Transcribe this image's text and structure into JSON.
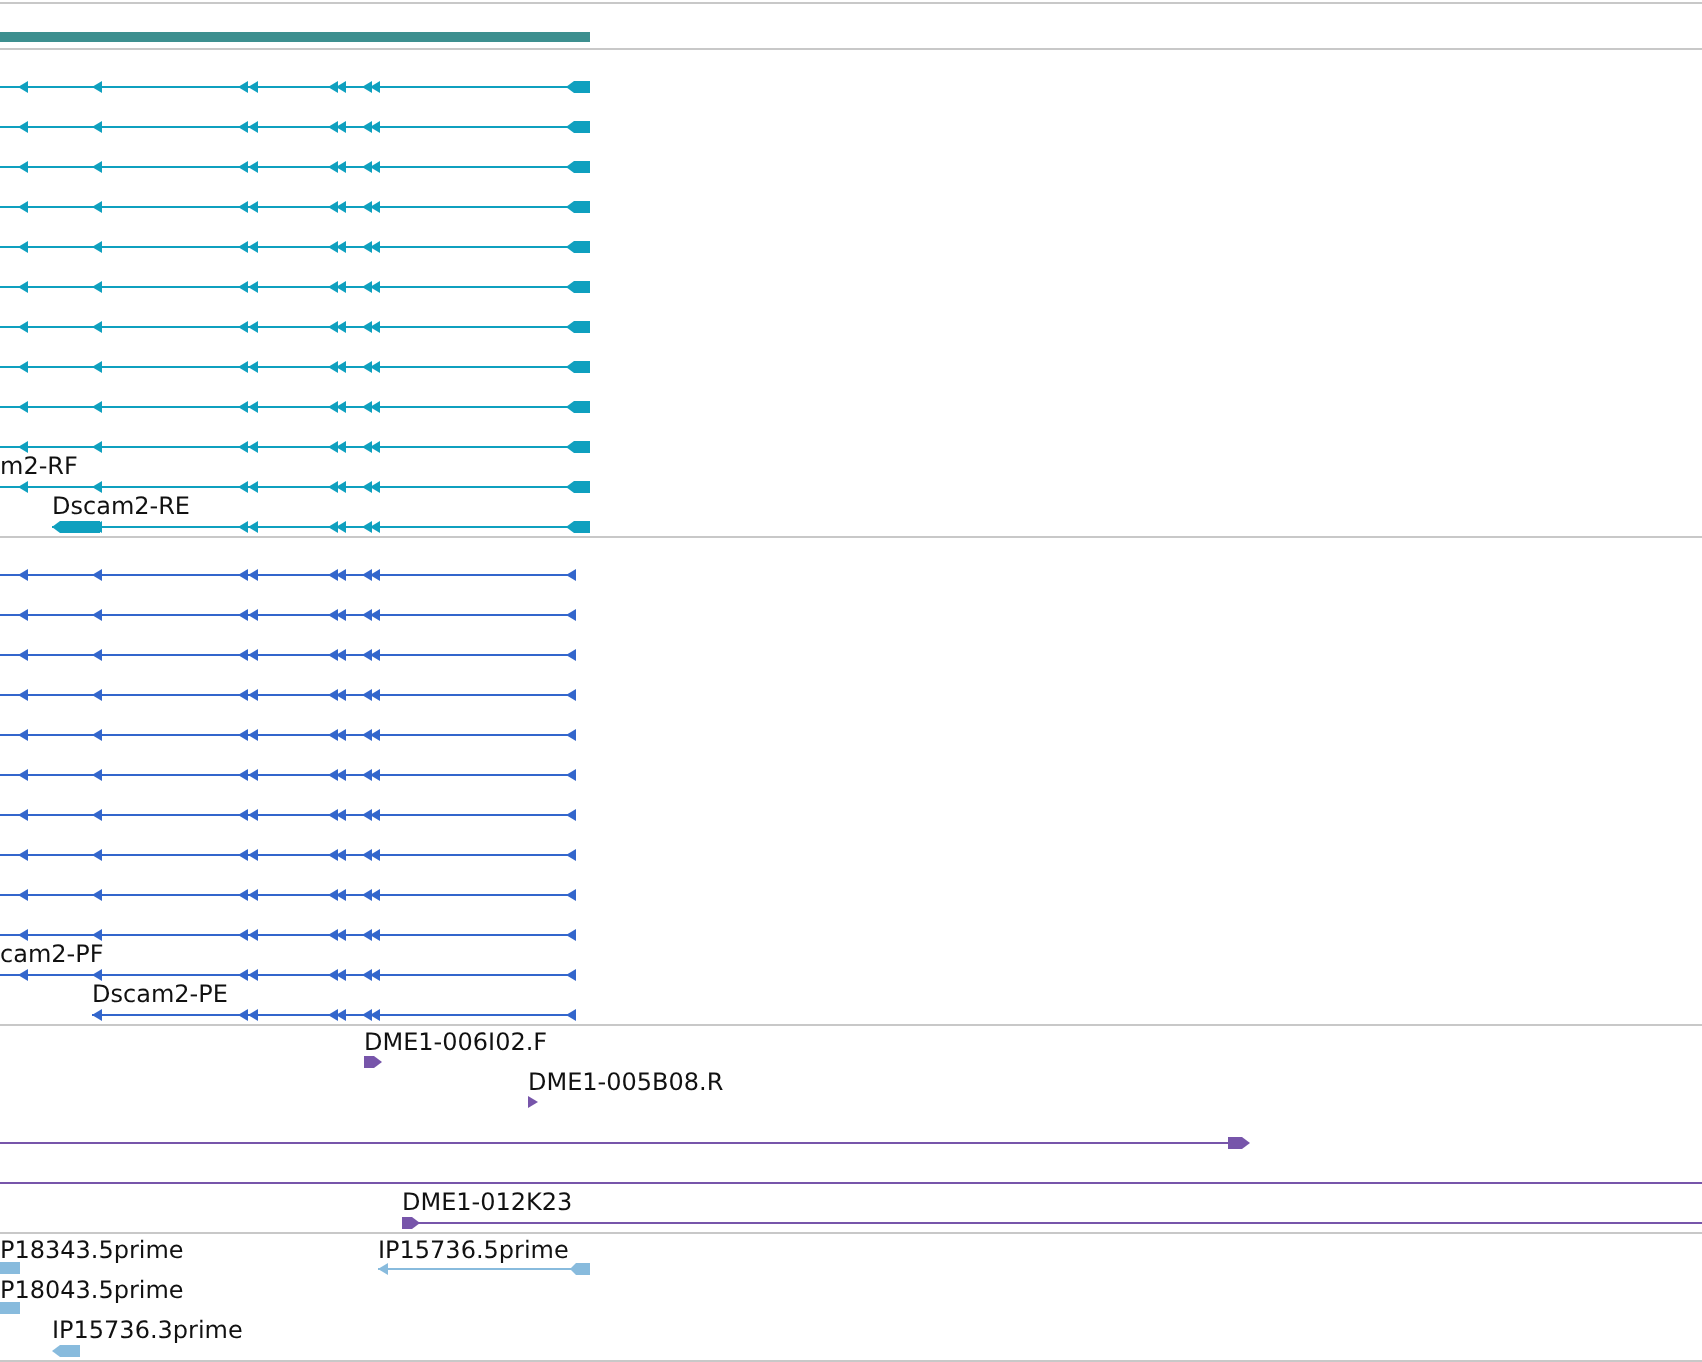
{
  "tracks": [
    {
      "kind": "gene",
      "color": "#3d8f8f"
    },
    {
      "kind": "transcripts",
      "color": "#0fa0bf",
      "rows": [
        {
          "kind": "full"
        },
        {
          "kind": "full"
        },
        {
          "kind": "full"
        },
        {
          "kind": "full"
        },
        {
          "kind": "full"
        },
        {
          "kind": "full"
        },
        {
          "kind": "full"
        },
        {
          "kind": "full"
        },
        {
          "kind": "full"
        },
        {
          "kind": "full"
        },
        {
          "kind": "full",
          "label": "m2-RF"
        },
        {
          "kind": "short",
          "label": "Dscam2-RE"
        }
      ]
    },
    {
      "kind": "proteins",
      "color": "#3366cc",
      "rows": [
        {
          "kind": "full"
        },
        {
          "kind": "full"
        },
        {
          "kind": "full"
        },
        {
          "kind": "full"
        },
        {
          "kind": "full"
        },
        {
          "kind": "full"
        },
        {
          "kind": "full"
        },
        {
          "kind": "full"
        },
        {
          "kind": "full"
        },
        {
          "kind": "full"
        },
        {
          "kind": "full",
          "label": "cam2-PF"
        },
        {
          "kind": "short",
          "label": "Dscam2-PE"
        }
      ]
    },
    {
      "kind": "reads",
      "color": "#7755aa",
      "rows": [
        {
          "kind": "read",
          "label": "DME1-006I02.F"
        },
        {
          "kind": "dot",
          "label": "DME1-005B08.R"
        },
        {
          "kind": "span"
        },
        {
          "kind": "clone",
          "label": "DME1-012K23"
        }
      ]
    },
    {
      "kind": "ests",
      "color": "#88bbdd",
      "rows": [
        {
          "kind": "block",
          "label": "P18343.5prime"
        },
        {
          "kind": "span",
          "label": "IP15736.5prime"
        },
        {
          "kind": "block",
          "label": "P18043.5prime"
        },
        {
          "kind": "arrow",
          "label": "IP15736.3prime"
        }
      ]
    }
  ]
}
